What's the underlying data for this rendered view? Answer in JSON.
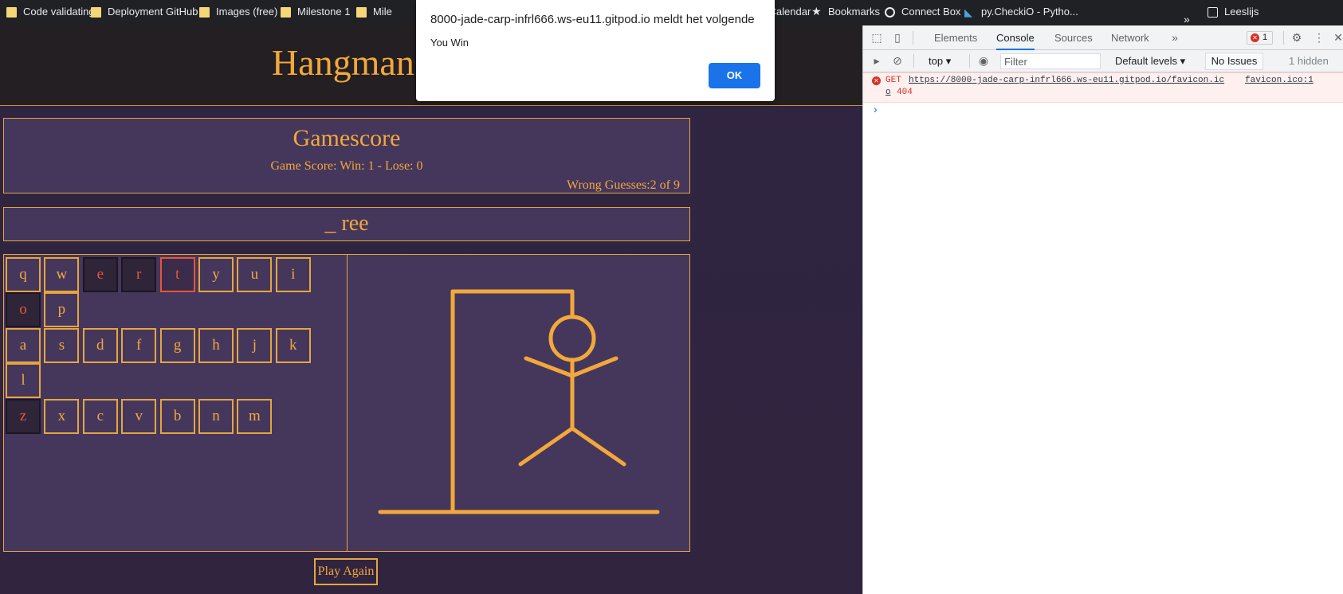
{
  "bookmarks": [
    {
      "label": "Code validating",
      "icon": "folder-icon"
    },
    {
      "label": "Deployment GitHub",
      "icon": "folder-icon"
    },
    {
      "label": "Images (free)",
      "icon": "folder-icon"
    },
    {
      "label": "Milestone 1",
      "icon": "folder-icon"
    },
    {
      "label": "Mile",
      "icon": "folder-icon"
    },
    {
      "label": "Google Calendar",
      "icon": "calendar-icon"
    },
    {
      "label": "Bookmarks",
      "icon": "star-icon"
    },
    {
      "label": "Connect Box",
      "icon": "globe-icon"
    },
    {
      "label": "py.CheckiO - Pytho...",
      "icon": "checkio-icon"
    },
    {
      "label": "Leeslijs",
      "icon": "reading-list-icon"
    }
  ],
  "game": {
    "title": "Hangman",
    "score_title": "Gamescore",
    "score_text": "Game Score: Win: 1 - Lose: 0",
    "wrong_text": "Wrong Guesses:2 of 9",
    "word": "_ ree",
    "play_again": "Play Again",
    "keys": [
      {
        "letter": "q",
        "state": "available"
      },
      {
        "letter": "w",
        "state": "available"
      },
      {
        "letter": "e",
        "state": "used"
      },
      {
        "letter": "r",
        "state": "used"
      },
      {
        "letter": "t",
        "state": "used-highlight"
      },
      {
        "letter": "y",
        "state": "available"
      },
      {
        "letter": "u",
        "state": "available"
      },
      {
        "letter": "i",
        "state": "available"
      },
      {
        "letter": "o",
        "state": "used"
      },
      {
        "letter": "p",
        "state": "available"
      },
      {
        "letter": "a",
        "state": "available"
      },
      {
        "letter": "s",
        "state": "available"
      },
      {
        "letter": "d",
        "state": "available"
      },
      {
        "letter": "f",
        "state": "available"
      },
      {
        "letter": "g",
        "state": "available"
      },
      {
        "letter": "h",
        "state": "available"
      },
      {
        "letter": "j",
        "state": "available"
      },
      {
        "letter": "k",
        "state": "available"
      },
      {
        "letter": "l",
        "state": "available"
      },
      {
        "letter": "z",
        "state": "used"
      },
      {
        "letter": "x",
        "state": "available"
      },
      {
        "letter": "c",
        "state": "available"
      },
      {
        "letter": "v",
        "state": "available"
      },
      {
        "letter": "b",
        "state": "available"
      },
      {
        "letter": "n",
        "state": "available"
      },
      {
        "letter": "m",
        "state": "available"
      }
    ]
  },
  "alert": {
    "title": "8000-jade-carp-infrl666.ws-eu11.gitpod.io meldt het volgende",
    "message": "You Win",
    "ok": "OK"
  },
  "devtools": {
    "tabs": [
      "Elements",
      "Console",
      "Sources",
      "Network"
    ],
    "active_tab": "Console",
    "error_count": "1",
    "context": "top",
    "filter_placeholder": "Filter",
    "levels": "Default levels",
    "issues": "No Issues",
    "hidden": "1 hidden",
    "error": {
      "method": "GET",
      "url": "https://8000-jade-carp-infrl666.ws-eu11.gitpod.io/favicon.ic",
      "url_cont": "o",
      "status": "404",
      "source": "favicon.ico:1"
    }
  },
  "colors": {
    "accent": "#f2a83a",
    "panel": "#45365c",
    "background": "#2f2540",
    "used_letter": "#e8553a"
  }
}
